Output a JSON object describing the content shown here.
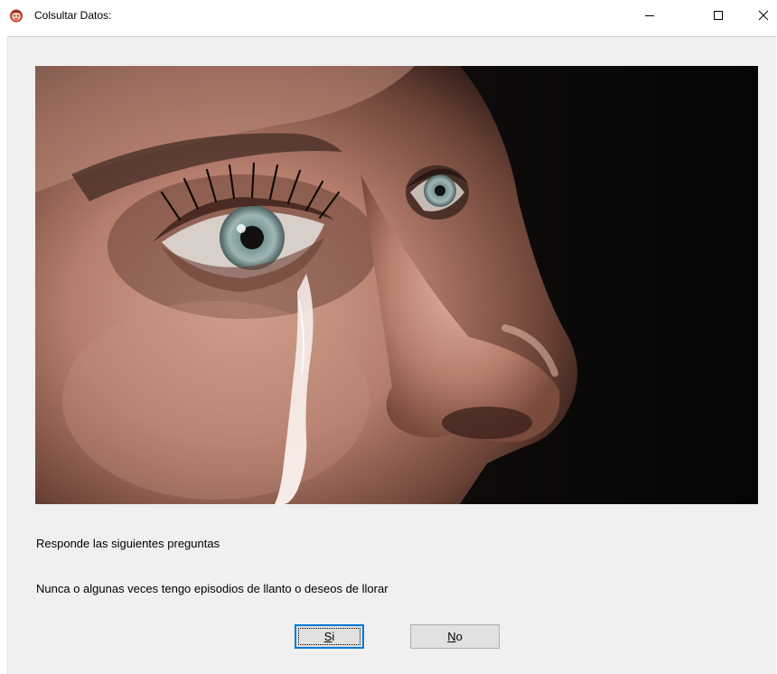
{
  "window": {
    "title": "Colsultar Datos:",
    "icon": "app-face-icon"
  },
  "titlebar_controls": {
    "minimize_icon": "minimize-icon",
    "maximize_icon": "maximize-icon",
    "close_icon": "close-icon"
  },
  "image": {
    "subject": "woman-crying-photo"
  },
  "labels": {
    "instructions": "Responde las siguientes preguntas",
    "question": "Nunca o algunas veces tengo episodios de llanto o deseos de llorar"
  },
  "buttons": {
    "yes": {
      "mnemonic": "S",
      "rest": "i"
    },
    "no": {
      "mnemonic": "N",
      "rest": "o"
    }
  },
  "colors": {
    "dialog_background": "#f0f0f0",
    "button_face": "#e1e1e1",
    "focus_border": "#0078d7"
  }
}
